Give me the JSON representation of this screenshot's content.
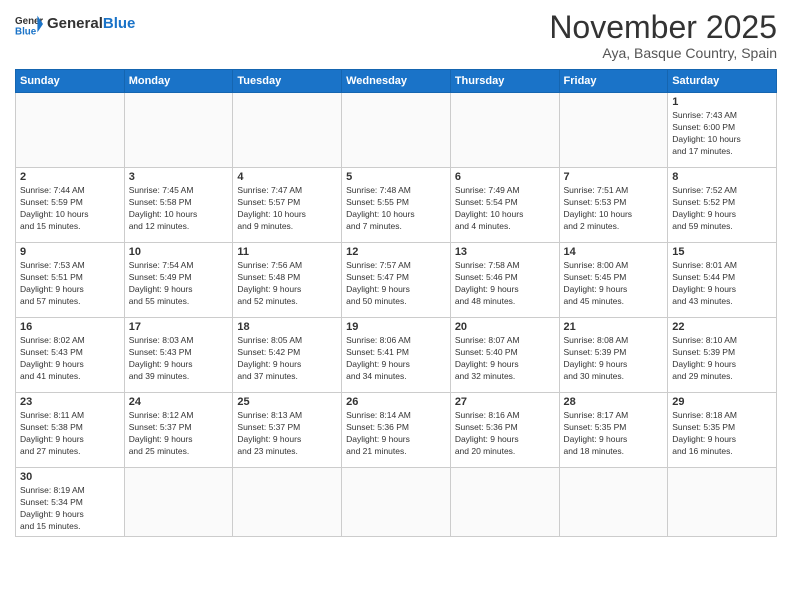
{
  "header": {
    "logo_general": "General",
    "logo_blue": "Blue",
    "month_title": "November 2025",
    "subtitle": "Aya, Basque Country, Spain"
  },
  "weekdays": [
    "Sunday",
    "Monday",
    "Tuesday",
    "Wednesday",
    "Thursday",
    "Friday",
    "Saturday"
  ],
  "days": [
    {
      "num": "",
      "info": ""
    },
    {
      "num": "",
      "info": ""
    },
    {
      "num": "",
      "info": ""
    },
    {
      "num": "",
      "info": ""
    },
    {
      "num": "",
      "info": ""
    },
    {
      "num": "",
      "info": ""
    },
    {
      "num": "1",
      "info": "Sunrise: 7:43 AM\nSunset: 6:00 PM\nDaylight: 10 hours\nand 17 minutes."
    },
    {
      "num": "2",
      "info": "Sunrise: 7:44 AM\nSunset: 5:59 PM\nDaylight: 10 hours\nand 15 minutes."
    },
    {
      "num": "3",
      "info": "Sunrise: 7:45 AM\nSunset: 5:58 PM\nDaylight: 10 hours\nand 12 minutes."
    },
    {
      "num": "4",
      "info": "Sunrise: 7:47 AM\nSunset: 5:57 PM\nDaylight: 10 hours\nand 9 minutes."
    },
    {
      "num": "5",
      "info": "Sunrise: 7:48 AM\nSunset: 5:55 PM\nDaylight: 10 hours\nand 7 minutes."
    },
    {
      "num": "6",
      "info": "Sunrise: 7:49 AM\nSunset: 5:54 PM\nDaylight: 10 hours\nand 4 minutes."
    },
    {
      "num": "7",
      "info": "Sunrise: 7:51 AM\nSunset: 5:53 PM\nDaylight: 10 hours\nand 2 minutes."
    },
    {
      "num": "8",
      "info": "Sunrise: 7:52 AM\nSunset: 5:52 PM\nDaylight: 9 hours\nand 59 minutes."
    },
    {
      "num": "9",
      "info": "Sunrise: 7:53 AM\nSunset: 5:51 PM\nDaylight: 9 hours\nand 57 minutes."
    },
    {
      "num": "10",
      "info": "Sunrise: 7:54 AM\nSunset: 5:49 PM\nDaylight: 9 hours\nand 55 minutes."
    },
    {
      "num": "11",
      "info": "Sunrise: 7:56 AM\nSunset: 5:48 PM\nDaylight: 9 hours\nand 52 minutes."
    },
    {
      "num": "12",
      "info": "Sunrise: 7:57 AM\nSunset: 5:47 PM\nDaylight: 9 hours\nand 50 minutes."
    },
    {
      "num": "13",
      "info": "Sunrise: 7:58 AM\nSunset: 5:46 PM\nDaylight: 9 hours\nand 48 minutes."
    },
    {
      "num": "14",
      "info": "Sunrise: 8:00 AM\nSunset: 5:45 PM\nDaylight: 9 hours\nand 45 minutes."
    },
    {
      "num": "15",
      "info": "Sunrise: 8:01 AM\nSunset: 5:44 PM\nDaylight: 9 hours\nand 43 minutes."
    },
    {
      "num": "16",
      "info": "Sunrise: 8:02 AM\nSunset: 5:43 PM\nDaylight: 9 hours\nand 41 minutes."
    },
    {
      "num": "17",
      "info": "Sunrise: 8:03 AM\nSunset: 5:43 PM\nDaylight: 9 hours\nand 39 minutes."
    },
    {
      "num": "18",
      "info": "Sunrise: 8:05 AM\nSunset: 5:42 PM\nDaylight: 9 hours\nand 37 minutes."
    },
    {
      "num": "19",
      "info": "Sunrise: 8:06 AM\nSunset: 5:41 PM\nDaylight: 9 hours\nand 34 minutes."
    },
    {
      "num": "20",
      "info": "Sunrise: 8:07 AM\nSunset: 5:40 PM\nDaylight: 9 hours\nand 32 minutes."
    },
    {
      "num": "21",
      "info": "Sunrise: 8:08 AM\nSunset: 5:39 PM\nDaylight: 9 hours\nand 30 minutes."
    },
    {
      "num": "22",
      "info": "Sunrise: 8:10 AM\nSunset: 5:39 PM\nDaylight: 9 hours\nand 29 minutes."
    },
    {
      "num": "23",
      "info": "Sunrise: 8:11 AM\nSunset: 5:38 PM\nDaylight: 9 hours\nand 27 minutes."
    },
    {
      "num": "24",
      "info": "Sunrise: 8:12 AM\nSunset: 5:37 PM\nDaylight: 9 hours\nand 25 minutes."
    },
    {
      "num": "25",
      "info": "Sunrise: 8:13 AM\nSunset: 5:37 PM\nDaylight: 9 hours\nand 23 minutes."
    },
    {
      "num": "26",
      "info": "Sunrise: 8:14 AM\nSunset: 5:36 PM\nDaylight: 9 hours\nand 21 minutes."
    },
    {
      "num": "27",
      "info": "Sunrise: 8:16 AM\nSunset: 5:36 PM\nDaylight: 9 hours\nand 20 minutes."
    },
    {
      "num": "28",
      "info": "Sunrise: 8:17 AM\nSunset: 5:35 PM\nDaylight: 9 hours\nand 18 minutes."
    },
    {
      "num": "29",
      "info": "Sunrise: 8:18 AM\nSunset: 5:35 PM\nDaylight: 9 hours\nand 16 minutes."
    },
    {
      "num": "30",
      "info": "Sunrise: 8:19 AM\nSunset: 5:34 PM\nDaylight: 9 hours\nand 15 minutes."
    },
    {
      "num": "",
      "info": ""
    },
    {
      "num": "",
      "info": ""
    },
    {
      "num": "",
      "info": ""
    },
    {
      "num": "",
      "info": ""
    },
    {
      "num": "",
      "info": ""
    },
    {
      "num": "",
      "info": ""
    }
  ]
}
